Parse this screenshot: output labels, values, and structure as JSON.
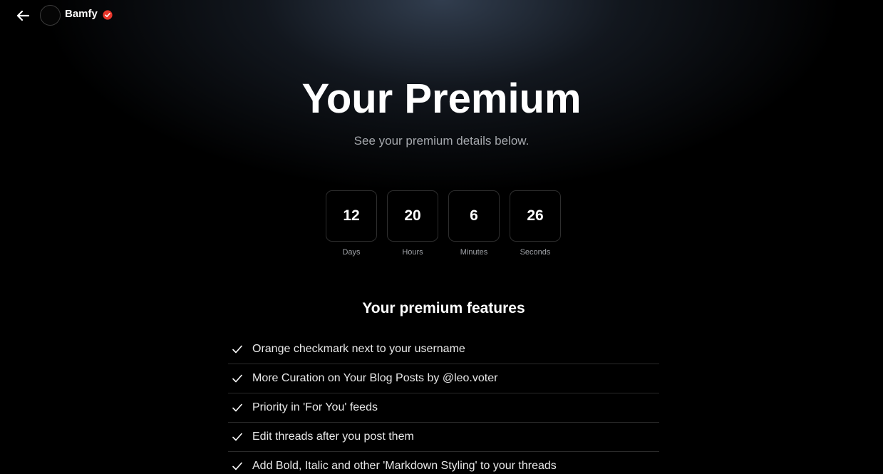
{
  "header": {
    "username": "Bamfy",
    "back_icon": "arrow-left-icon",
    "verified_icon": "verified-check-icon",
    "verified_color": "#e8362b"
  },
  "main": {
    "title": "Your Premium",
    "subtitle": "See your premium details below."
  },
  "countdown": [
    {
      "value": "12",
      "label": "Days"
    },
    {
      "value": "20",
      "label": "Hours"
    },
    {
      "value": "6",
      "label": "Minutes"
    },
    {
      "value": "26",
      "label": "Seconds"
    }
  ],
  "features": {
    "heading": "Your premium features",
    "items": [
      "Orange checkmark next to your username",
      "More Curation on Your Blog Posts by @leo.voter",
      "Priority in 'For You' feeds",
      "Edit threads after you post them",
      "Add Bold, Italic and other 'Markdown Styling' to your threads"
    ]
  }
}
